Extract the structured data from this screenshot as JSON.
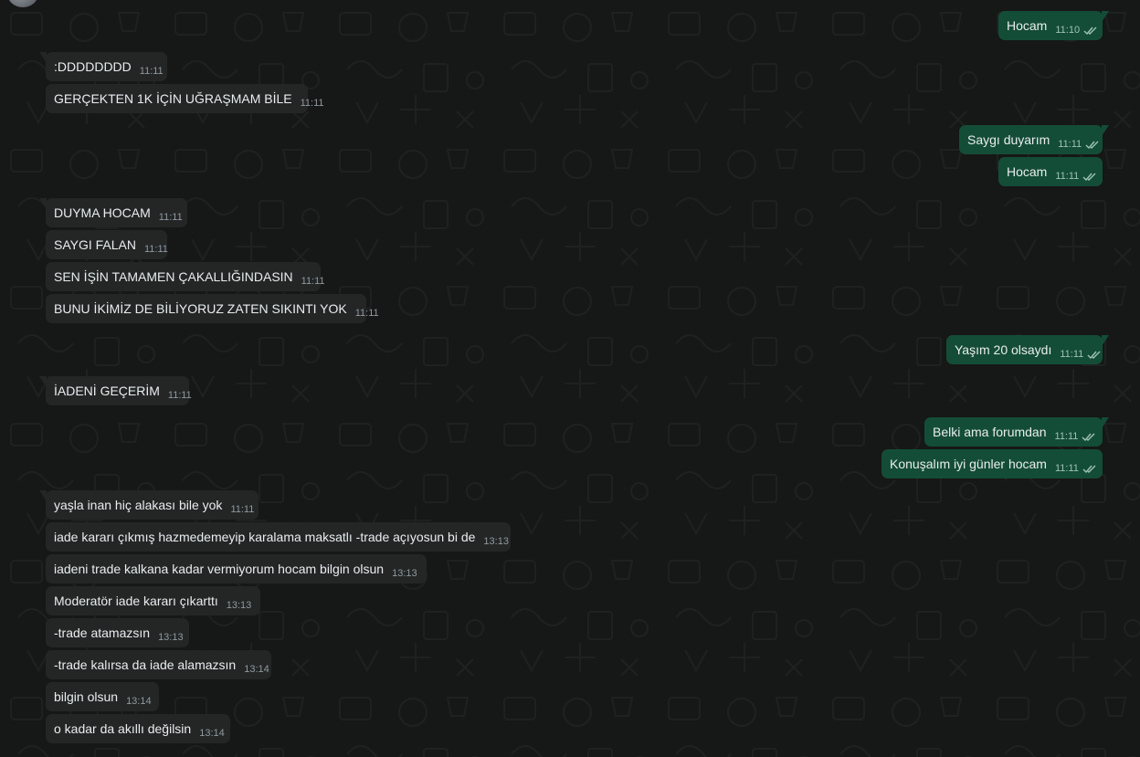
{
  "chat": {
    "outgoing": [
      {
        "text": "Hocam",
        "time": "11:10"
      },
      {
        "text": "Saygı duyarım",
        "time": "11:11"
      },
      {
        "text": "Hocam",
        "time": "11:11"
      },
      {
        "text": "Yaşım 20 olsaydı",
        "time": "11:11"
      },
      {
        "text": "Belki ama forumdan",
        "time": "11:11"
      },
      {
        "text": "Konuşalım iyi günler hocam",
        "time": "11:11"
      }
    ],
    "incoming": [
      {
        "text": ":DDDDDDDD",
        "time": "11:11"
      },
      {
        "text": "GERÇEKTEN 1K İÇİN UĞRAŞMAM BİLE",
        "time": "11:11"
      },
      {
        "text": "DUYMA HOCAM",
        "time": "11:11"
      },
      {
        "text": "SAYGI FALAN",
        "time": "11:11"
      },
      {
        "text": "SEN İŞİN TAMAMEN ÇAKALLIĞINDASIN",
        "time": "11:11"
      },
      {
        "text": "BUNU İKİMİZ DE BİLİYORUZ ZATEN SIKINTI YOK",
        "time": "11:11"
      },
      {
        "text": "İADENİ GEÇERİM",
        "time": "11:11"
      },
      {
        "text": "yaşla inan hiç alakası bile yok",
        "time": "11:11"
      },
      {
        "text": "iade kararı çıkmış hazmedemeyip karalama maksatlı -trade açıyosun bi de",
        "time": "13:13"
      },
      {
        "text": "iadeni trade kalkana kadar vermiyorum hocam bilgin olsun",
        "time": "13:13"
      },
      {
        "text": "Moderatör iade kararı çıkarttı",
        "time": "13:13"
      },
      {
        "text": "-trade atamazsın",
        "time": "13:13"
      },
      {
        "text": "-trade kalırsa da iade alamazsın",
        "time": "13:14"
      },
      {
        "text": "bilgin olsun",
        "time": "13:14"
      },
      {
        "text": "o kadar da akıllı değilsin",
        "time": "13:14"
      }
    ]
  },
  "icons": {
    "read_receipt": "double-check-icon",
    "avatar": "contact-avatar"
  },
  "colors": {
    "background": "#161717",
    "incoming_bubble": "#242626",
    "outgoing_bubble": "#144d37",
    "text": "#e9edef",
    "timestamp_incoming": "#8f9aa0",
    "timestamp_outgoing": "#9fc3b4"
  }
}
